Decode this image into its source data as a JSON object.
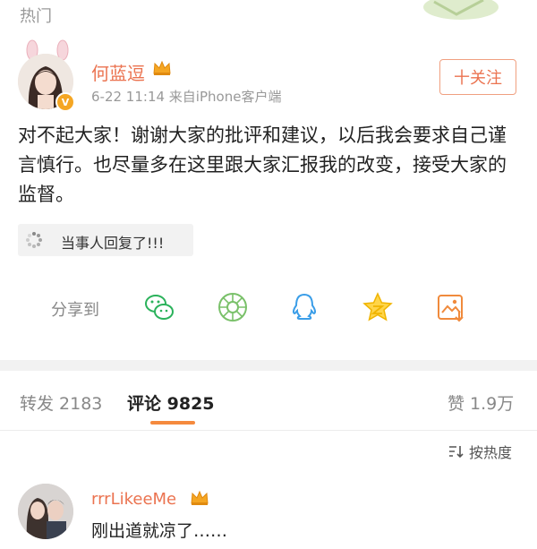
{
  "top": {
    "label": "热门"
  },
  "post": {
    "author": "何蓝逗",
    "meta": "6-22 11:14  来自iPhone客户端",
    "follow_label": "十关注",
    "content": "对不起大家！谢谢大家的批评和建议，以后我会要求自己谨言慎行。也尽量多在这里跟大家汇报我的改变，接受大家的监督。",
    "topic": "当事人回复了!!!"
  },
  "share": {
    "label": "分享到",
    "icons": [
      "wechat-icon",
      "moments-icon",
      "qq-icon",
      "qzone-icon",
      "save-image-icon"
    ]
  },
  "tabs": {
    "repost": "转发 2183",
    "comment_label": "评论",
    "comment_count": "9825",
    "like": "赞 1.9万"
  },
  "sort": {
    "label": "按热度"
  },
  "comment": {
    "user": "rrrLikeeMe",
    "text": "刚出道就凉了……"
  },
  "colors": {
    "accent": "#eb7350",
    "underline": "#f58a3e",
    "divider": "#f2f2f2"
  }
}
